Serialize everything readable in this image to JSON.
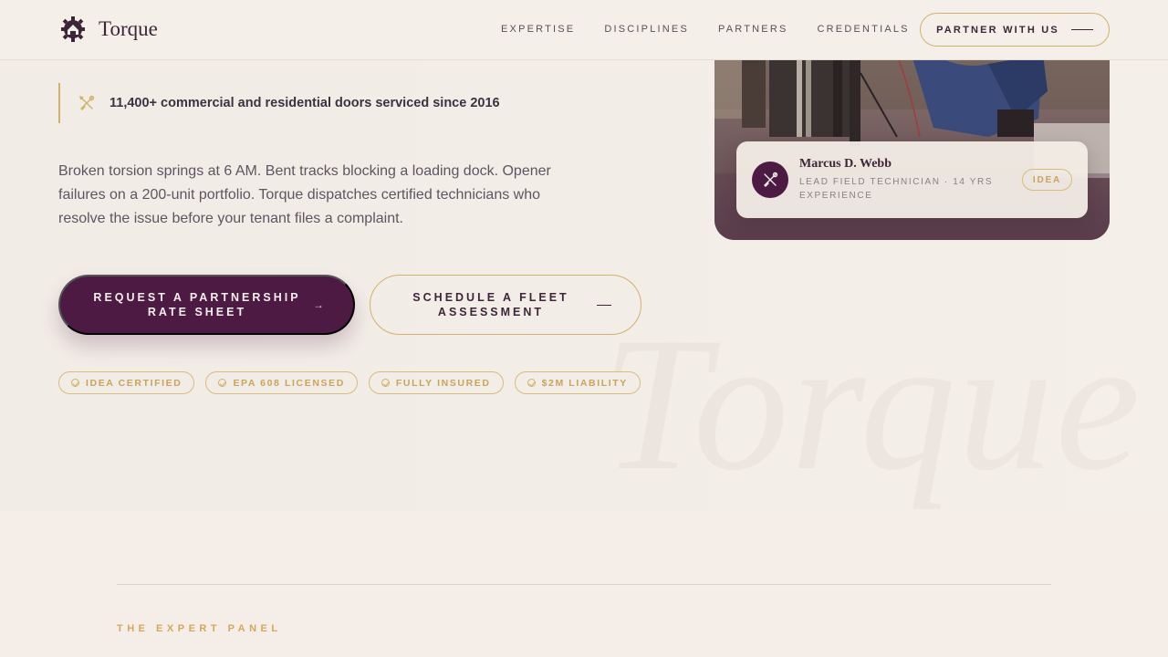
{
  "brand": {
    "name": "Torque",
    "logo_icon": "garage-gear-icon",
    "color_primary": "#4d1a44",
    "color_accent": "#d2b26a"
  },
  "nav": {
    "links": [
      "EXPERTISE",
      "DISCIPLINES",
      "PARTNERS",
      "CREDENTIALS"
    ],
    "cta_label": "PARTNER WITH US"
  },
  "hero": {
    "stat_icon": "wrench-screwdriver-icon",
    "stat_text": "11,400+ commercial and residential doors serviced since 2016",
    "lead": "Broken torsion springs at 6 AM. Bent tracks blocking a loading dock. Opener failures on a 200-unit portfolio. Torque dispatches certified technicians who resolve the issue before your tenant files a complaint.",
    "primary_cta": "REQUEST A PARTNERSHIP RATE SHEET",
    "primary_arrow": "→",
    "secondary_cta": "SCHEDULE A FLEET ASSESSMENT",
    "badges": [
      "IDEA CERTIFIED",
      "EPA 608 LICENSED",
      "FULLY INSURED",
      "$2M LIABILITY"
    ],
    "watermark": "Torque"
  },
  "technician": {
    "name": "Marcus D. Webb",
    "role": "LEAD FIELD TECHNICIAN · 14 YRS EXPERIENCE",
    "badge": "IDEA",
    "avatar_icon": "tools-icon"
  },
  "section": {
    "eyebrow": "THE EXPERT PANEL"
  }
}
